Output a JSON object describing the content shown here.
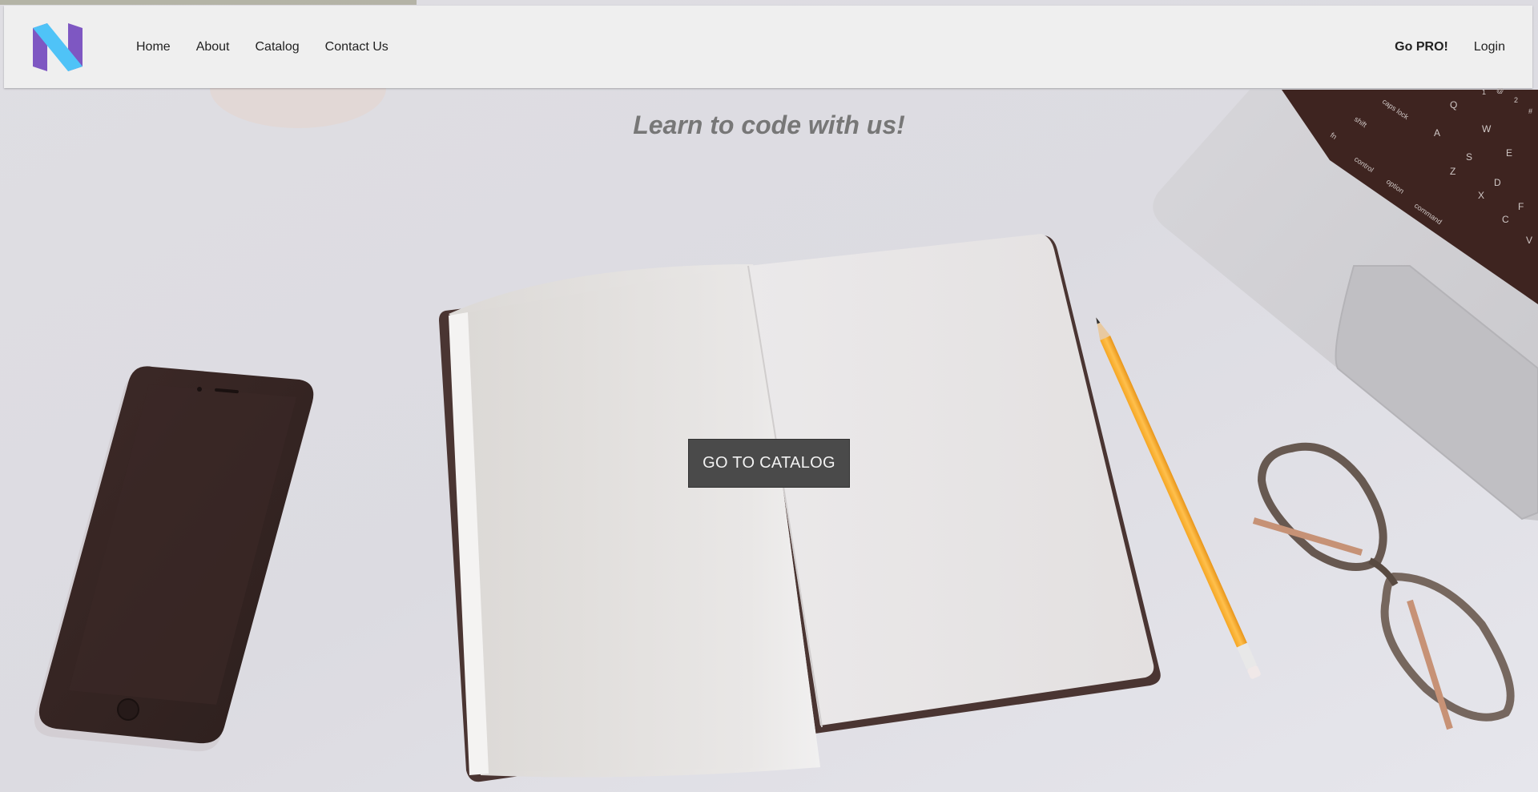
{
  "nav": {
    "logo_icon": "n-logo-icon",
    "left_links": [
      "Home",
      "About",
      "Catalog",
      "Contact Us"
    ],
    "right_links": [
      "Go PRO!",
      "Login"
    ]
  },
  "hero": {
    "tagline": "Learn to code with us!",
    "cta_label": "GO TO CATALOG"
  },
  "background": {
    "description_icon": "desk-scene-illustration",
    "laptop_keys": [
      "caps lock",
      "shift",
      "fn",
      "control",
      "option",
      "command",
      "Q",
      "W",
      "E",
      "A",
      "S",
      "D",
      "F",
      "Z",
      "X",
      "C",
      "V",
      "1",
      "2",
      "@",
      "#"
    ]
  },
  "colors": {
    "navbar_bg": "#efefef",
    "cta_bg": "#4a4a4a",
    "tagline": "#777777",
    "logo_blue": "#4fc3f7",
    "logo_purple": "#7e57c2"
  }
}
